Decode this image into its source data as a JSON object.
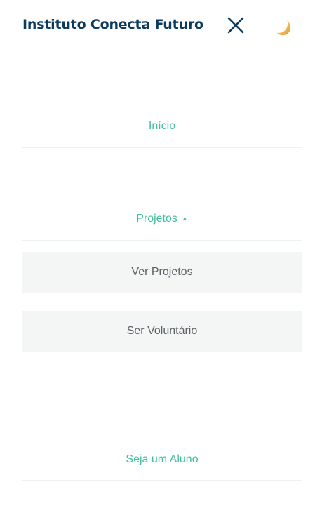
{
  "header": {
    "brand": "Instituto Conecta Futuro",
    "close_icon": "close-icon",
    "theme_icon": "moon-icon"
  },
  "menu": {
    "inicio": "Início",
    "projetos": "Projetos",
    "projetos_caret": "▲",
    "projetos_expanded": true,
    "submenu": [
      "Ver Projetos",
      "Ser Voluntário"
    ],
    "seja_aluno": "Seja um Aluno"
  },
  "colors": {
    "brand": "#0d3b5e",
    "accent": "#3fbf9e",
    "submenu_bg": "#f4f5f5",
    "submenu_text": "#5b6166",
    "moon": "#f2b84b"
  }
}
